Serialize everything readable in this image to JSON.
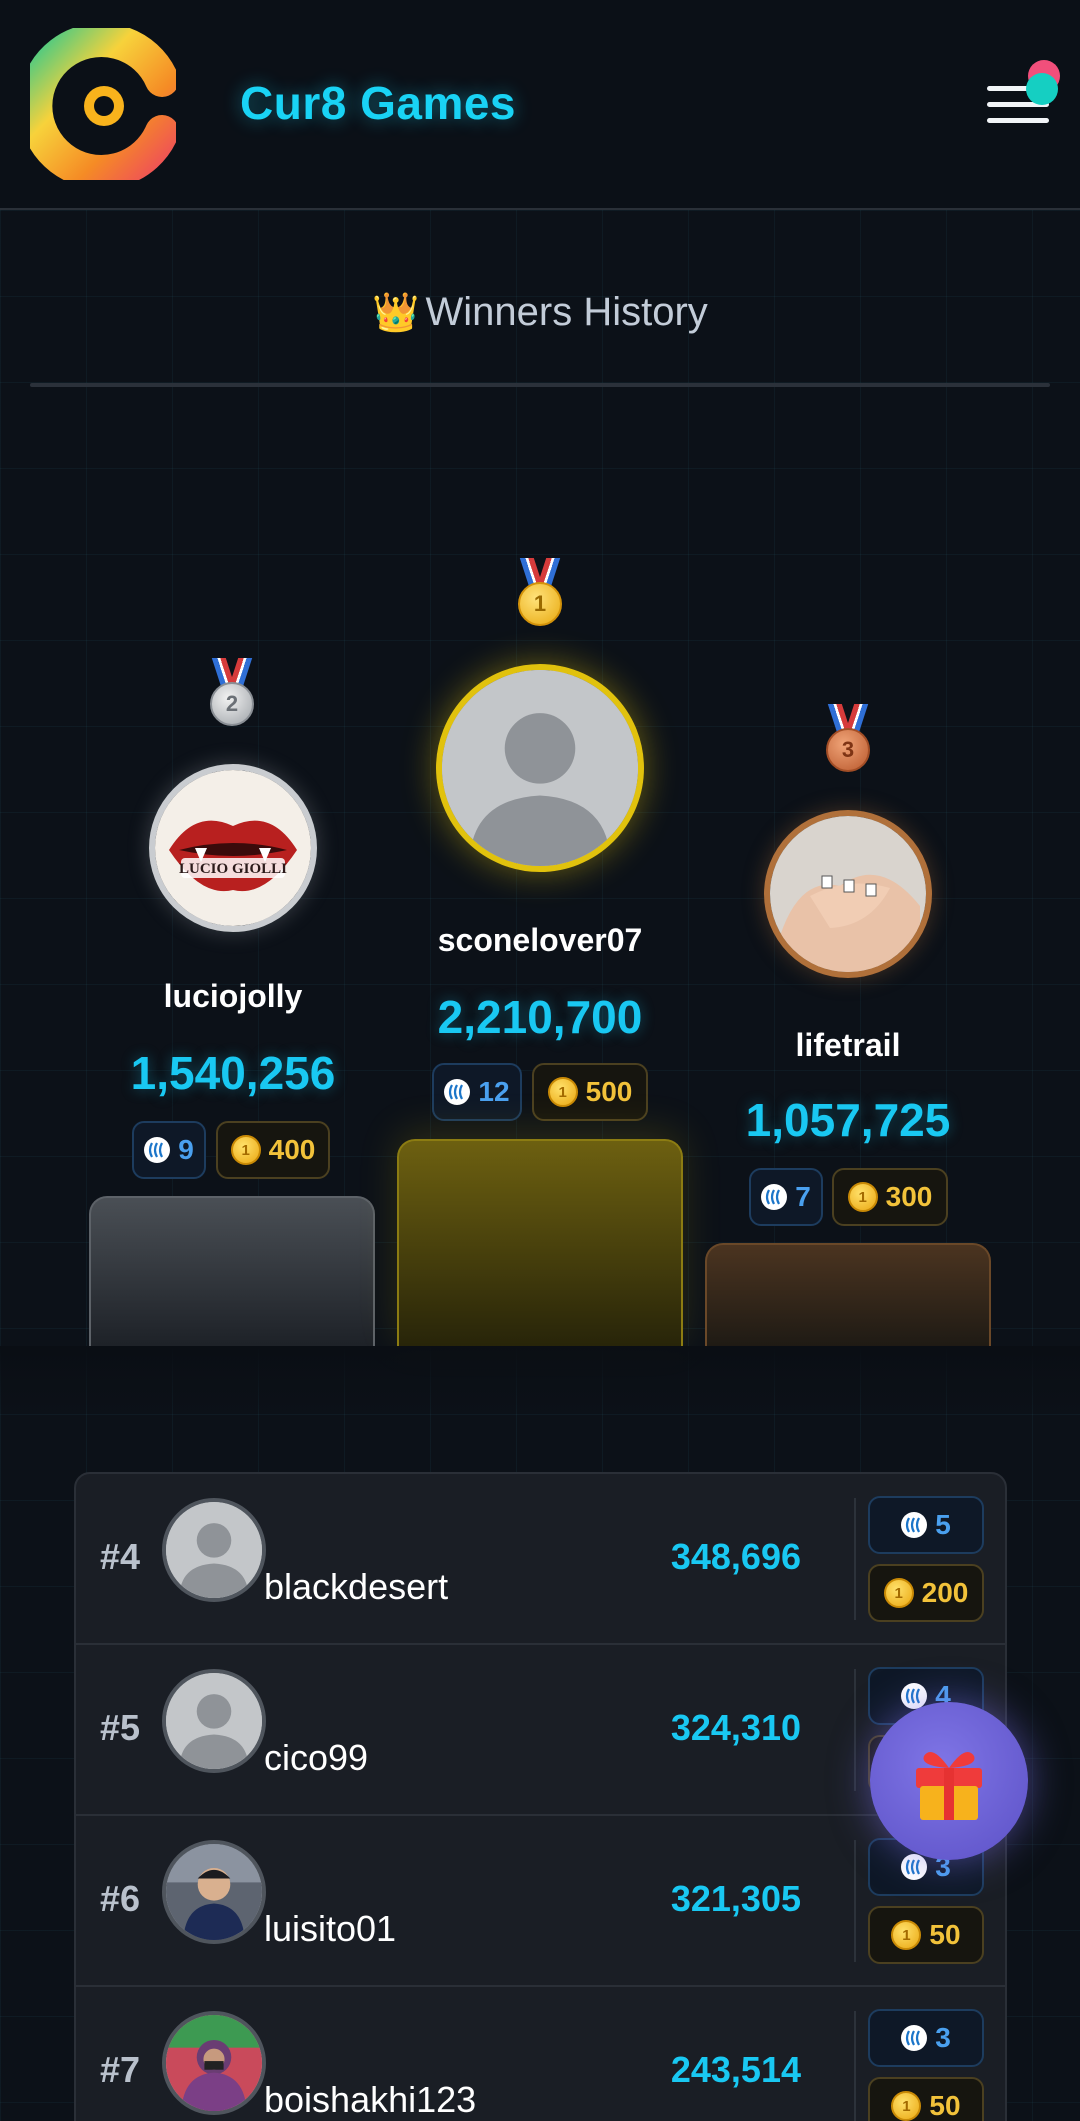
{
  "header": {
    "app_title": "Cur8 Games",
    "logo_icon": "cur8-logo-icon",
    "menu_icon": "hamburger-menu-icon"
  },
  "section": {
    "title": "Winners History",
    "title_icon": "crown-icon"
  },
  "podium": [
    {
      "rank": 2,
      "medal_label": "2",
      "medal": "silver-medal-icon",
      "name": "luciojolly",
      "score": "1,540,256",
      "steem": "9",
      "coins": "400",
      "avatar": "lips-logo-avatar"
    },
    {
      "rank": 1,
      "medal_label": "1",
      "medal": "gold-medal-icon",
      "name": "sconelover07",
      "score": "2,210,700",
      "steem": "12",
      "coins": "500",
      "avatar": "default-user-avatar"
    },
    {
      "rank": 3,
      "medal_label": "3",
      "medal": "bronze-medal-icon",
      "name": "lifetrail",
      "score": "1,057,725",
      "steem": "7",
      "coins": "300",
      "avatar": "hands-photo-avatar"
    }
  ],
  "rankings": [
    {
      "rank": "#4",
      "name": "blackdesert",
      "score": "348,696",
      "steem": "5",
      "coins": "200",
      "avatar": "default-user-avatar"
    },
    {
      "rank": "#5",
      "name": "cico99",
      "score": "324,310",
      "steem": "4",
      "coins": "",
      "avatar": "default-user-avatar"
    },
    {
      "rank": "#6",
      "name": "luisito01",
      "score": "321,305",
      "steem": "3",
      "coins": "50",
      "avatar": "boy-photo-avatar"
    },
    {
      "rank": "#7",
      "name": "boishakhi123",
      "score": "243,514",
      "steem": "3",
      "coins": "50",
      "avatar": "woman-photo-avatar"
    }
  ],
  "gift_button": {
    "icon": "gift-icon"
  },
  "colors": {
    "accent_cyan": "#19d3f5",
    "gold": "#e1c20d",
    "silver": "#c9ccd0",
    "bronze": "#b0703a",
    "coin": "#f2c23a",
    "steem": "#4aa0ef",
    "gift_fab": "#6e63d8"
  }
}
